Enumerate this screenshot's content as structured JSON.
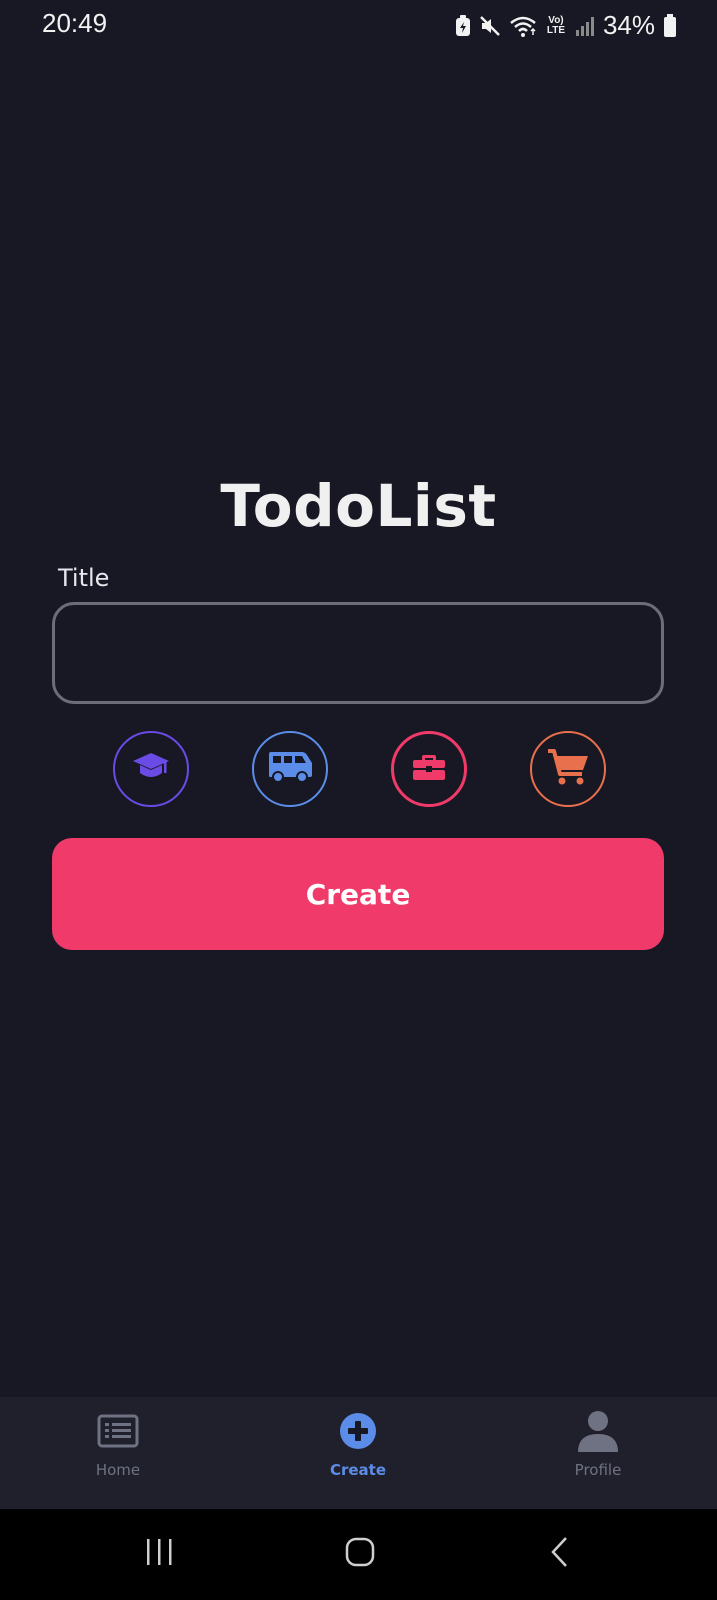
{
  "status_bar": {
    "time": "20:49",
    "network_label": "Vo) LTE",
    "battery": "34%"
  },
  "app": {
    "title": "TodoList"
  },
  "form": {
    "title_label": "Title",
    "title_value": "",
    "title_placeholder": "",
    "categories": [
      {
        "name": "education",
        "icon": "graduation-cap-icon",
        "color": "#6a4be6"
      },
      {
        "name": "travel",
        "icon": "van-icon",
        "color": "#5b8de8"
      },
      {
        "name": "work",
        "icon": "briefcase-icon",
        "color": "#f03a6a",
        "selected": true
      },
      {
        "name": "shopping",
        "icon": "cart-icon",
        "color": "#e8704c"
      }
    ],
    "create_label": "Create"
  },
  "bottom_nav": {
    "items": [
      {
        "label": "Home",
        "icon": "list-icon"
      },
      {
        "label": "Create",
        "icon": "add-circle-icon",
        "active": true
      },
      {
        "label": "Profile",
        "icon": "person-icon"
      }
    ]
  },
  "colors": {
    "background": "#181824",
    "accent": "#f03a6a",
    "nav_active": "#5b8de8",
    "nav_inactive": "#6f7282"
  }
}
